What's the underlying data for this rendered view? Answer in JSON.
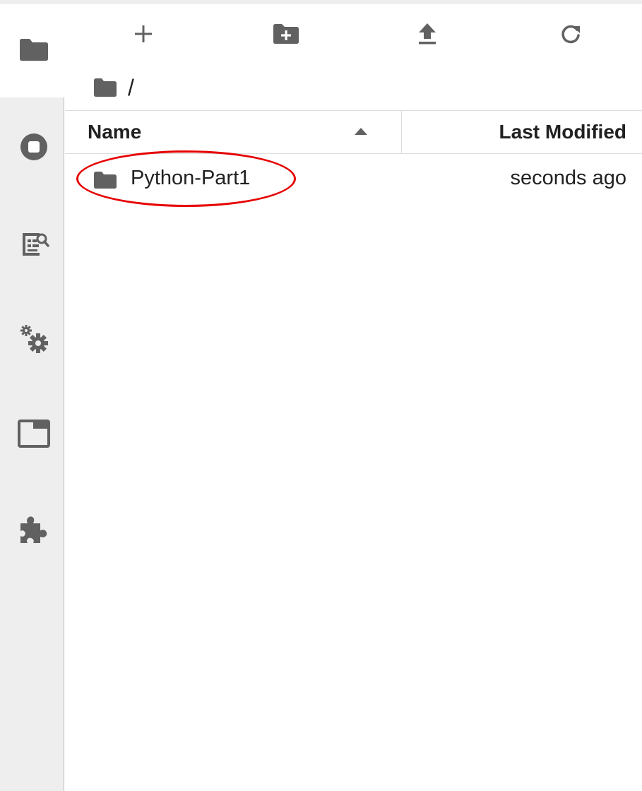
{
  "toolbar": {
    "new_launcher": {
      "icon": "plus-icon",
      "label": "+"
    },
    "new_folder": {
      "icon": "new-folder-icon"
    },
    "upload": {
      "icon": "upload-icon"
    },
    "refresh": {
      "icon": "refresh-icon"
    }
  },
  "breadcrumb": {
    "icon": "folder-icon",
    "separator": "/"
  },
  "sidebar": {
    "items": [
      {
        "icon": "folder-icon",
        "active": true
      },
      {
        "icon": "stop-circle-icon"
      },
      {
        "icon": "property-inspector-icon"
      },
      {
        "icon": "gears-icon"
      },
      {
        "icon": "tabs-icon"
      },
      {
        "icon": "puzzle-piece-icon"
      }
    ]
  },
  "table": {
    "columns": {
      "name": "Name",
      "last_modified": "Last Modified"
    },
    "sort": "ascending",
    "rows": [
      {
        "type": "folder",
        "name": "Python-Part1",
        "modified": "seconds ago"
      }
    ]
  },
  "colors": {
    "icon": "#616161",
    "text": "#212121",
    "sidebar_bg": "#eeeeee",
    "highlight": "#e60000"
  }
}
